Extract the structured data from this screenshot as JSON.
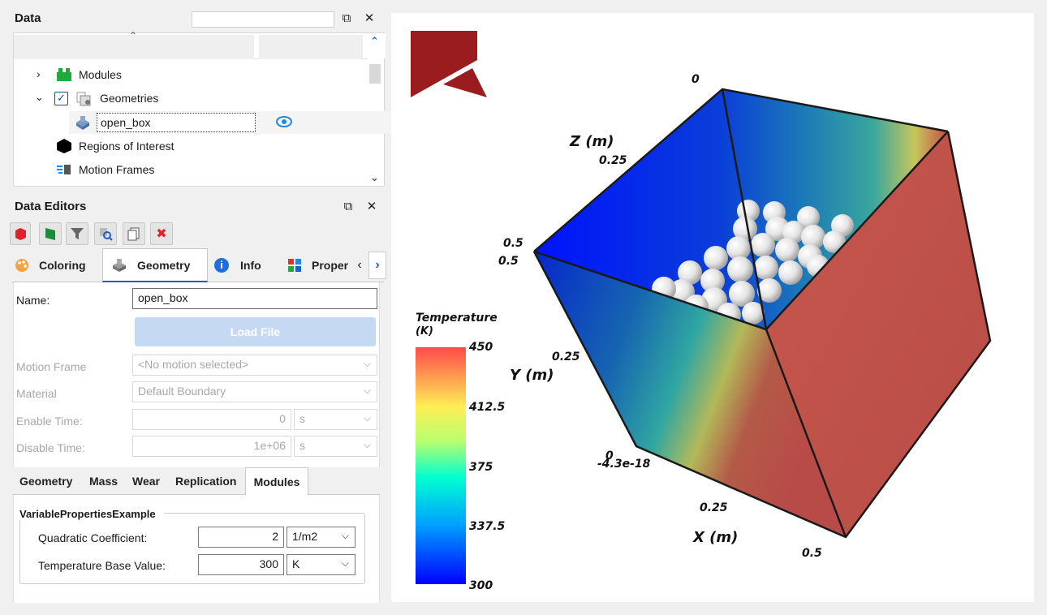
{
  "data_panel": {
    "title": "Data",
    "search_value": "",
    "tree": [
      {
        "label": "Modules",
        "icon": "modules-icon"
      },
      {
        "label": "Geometries",
        "icon": "geometries-icon",
        "checked": true
      },
      {
        "label": "open_box",
        "icon": "geometry-icon",
        "selected": true
      },
      {
        "label": "Regions of Interest",
        "icon": "regions-icon"
      },
      {
        "label": "Motion Frames",
        "icon": "motion-frames-icon"
      }
    ]
  },
  "editors_panel": {
    "title": "Data Editors",
    "tabs": [
      "Coloring",
      "Geometry",
      "Info",
      "Proper"
    ],
    "active_tab": "Geometry",
    "name_label": "Name:",
    "name_value": "open_box",
    "load_file_label": "Load File",
    "motion_frame_label": "Motion Frame",
    "motion_frame_value": "<No motion selected>",
    "material_label": "Material",
    "material_value": "Default Boundary",
    "enable_time_label": "Enable Time:",
    "enable_time_value": "0",
    "enable_time_unit": "s",
    "disable_time_label": "Disable Time:",
    "disable_time_value": "1e+06",
    "disable_time_unit": "s",
    "subtabs": [
      "Geometry",
      "Mass",
      "Wear",
      "Replication",
      "Modules"
    ],
    "active_subtab": "Modules",
    "group_title": "VariablePropertiesExample",
    "quad_coef_label": "Quadratic Coefficient:",
    "quad_coef_value": "2",
    "quad_coef_unit": "1/m2",
    "temp_base_label": "Temperature Base Value:",
    "temp_base_value": "300",
    "temp_base_unit": "K"
  },
  "viewport": {
    "legend_title_line1": "Temperature",
    "legend_title_line2": "(K)",
    "legend_ticks": [
      "450",
      "412.5",
      "375",
      "337.5",
      "300"
    ],
    "axes": {
      "z_label": "Z (m)",
      "y_label": "Y (m)",
      "x_label": "X (m)",
      "z_top_tick": "0",
      "z_mid_tick": "0.25",
      "y_end_tick_a": "0.5",
      "y_end_tick_b": "0.5",
      "y_mid_tick": "0.25",
      "origin_tick": "0",
      "origin_value": "-4.3e-18",
      "x_mid_tick": "0.25",
      "x_end_tick": "0.5"
    },
    "colors": {
      "logo": "#9b1c1f",
      "cold": "#0000ff",
      "hot": "#ff4a4a"
    }
  }
}
